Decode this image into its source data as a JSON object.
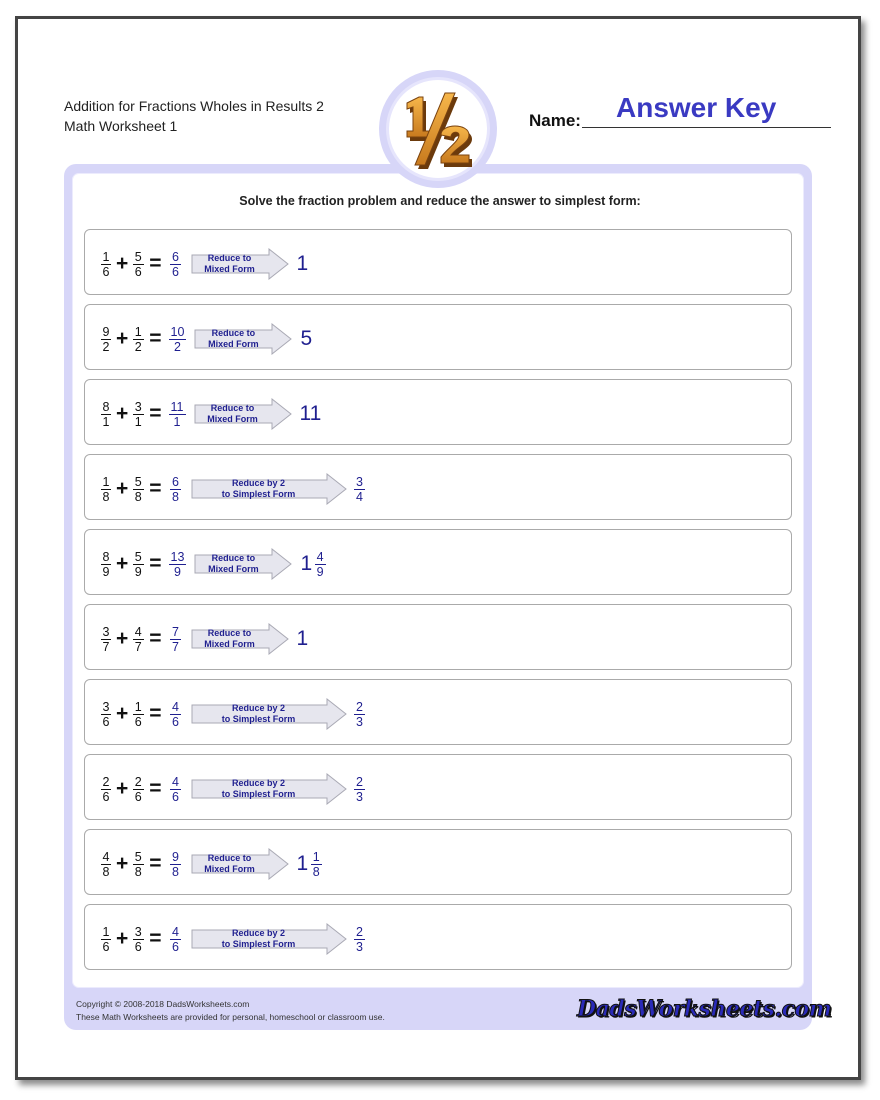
{
  "header": {
    "title_line1": "Addition for Fractions Wholes in Results 2",
    "title_line2": "Math Worksheet 1",
    "name_label": "Name:",
    "name_value": "Answer Key",
    "logo": "one-half-fraction-logo"
  },
  "instructions": "Solve the fraction problem and reduce the answer to simplest form:",
  "colors": {
    "frame": "#d7d6f8",
    "answer_blue": "#1f1f8f",
    "answer_key": "#3a3ac2",
    "logo_orange": "#c87a1e"
  },
  "problems": [
    {
      "a": {
        "n": "1",
        "d": "6"
      },
      "b": {
        "n": "5",
        "d": "6"
      },
      "sum": {
        "n": "6",
        "d": "6"
      },
      "arrow": [
        "Reduce to",
        "Mixed Form"
      ],
      "kind": "mixed",
      "result": {
        "whole": "1"
      }
    },
    {
      "a": {
        "n": "9",
        "d": "2"
      },
      "b": {
        "n": "1",
        "d": "2"
      },
      "sum": {
        "n": "10",
        "d": "2"
      },
      "arrow": [
        "Reduce to",
        "Mixed Form"
      ],
      "kind": "mixed",
      "result": {
        "whole": "5"
      }
    },
    {
      "a": {
        "n": "8",
        "d": "1"
      },
      "b": {
        "n": "3",
        "d": "1"
      },
      "sum": {
        "n": "11",
        "d": "1"
      },
      "arrow": [
        "Reduce to",
        "Mixed Form"
      ],
      "kind": "mixed",
      "result": {
        "whole": "11"
      }
    },
    {
      "a": {
        "n": "1",
        "d": "8"
      },
      "b": {
        "n": "5",
        "d": "8"
      },
      "sum": {
        "n": "6",
        "d": "8"
      },
      "arrow": [
        "Reduce by 2",
        "to Simplest Form"
      ],
      "kind": "simplest",
      "result": {
        "n": "3",
        "d": "4"
      }
    },
    {
      "a": {
        "n": "8",
        "d": "9"
      },
      "b": {
        "n": "5",
        "d": "9"
      },
      "sum": {
        "n": "13",
        "d": "9"
      },
      "arrow": [
        "Reduce to",
        "Mixed Form"
      ],
      "kind": "mixed",
      "result": {
        "whole": "1",
        "n": "4",
        "d": "9"
      }
    },
    {
      "a": {
        "n": "3",
        "d": "7"
      },
      "b": {
        "n": "4",
        "d": "7"
      },
      "sum": {
        "n": "7",
        "d": "7"
      },
      "arrow": [
        "Reduce to",
        "Mixed Form"
      ],
      "kind": "mixed",
      "result": {
        "whole": "1"
      }
    },
    {
      "a": {
        "n": "3",
        "d": "6"
      },
      "b": {
        "n": "1",
        "d": "6"
      },
      "sum": {
        "n": "4",
        "d": "6"
      },
      "arrow": [
        "Reduce by 2",
        "to Simplest Form"
      ],
      "kind": "simplest",
      "result": {
        "n": "2",
        "d": "3"
      }
    },
    {
      "a": {
        "n": "2",
        "d": "6"
      },
      "b": {
        "n": "2",
        "d": "6"
      },
      "sum": {
        "n": "4",
        "d": "6"
      },
      "arrow": [
        "Reduce by 2",
        "to Simplest Form"
      ],
      "kind": "simplest",
      "result": {
        "n": "2",
        "d": "3"
      }
    },
    {
      "a": {
        "n": "4",
        "d": "8"
      },
      "b": {
        "n": "5",
        "d": "8"
      },
      "sum": {
        "n": "9",
        "d": "8"
      },
      "arrow": [
        "Reduce to",
        "Mixed Form"
      ],
      "kind": "mixed",
      "result": {
        "whole": "1",
        "n": "1",
        "d": "8"
      }
    },
    {
      "a": {
        "n": "1",
        "d": "6"
      },
      "b": {
        "n": "3",
        "d": "6"
      },
      "sum": {
        "n": "4",
        "d": "6"
      },
      "arrow": [
        "Reduce by 2",
        "to Simplest Form"
      ],
      "kind": "simplest",
      "result": {
        "n": "2",
        "d": "3"
      }
    }
  ],
  "symbols": {
    "plus": "+",
    "equals": "="
  },
  "footer": {
    "copyright": "Copyright © 2008-2018 DadsWorksheets.com",
    "usage": "These Math Worksheets are provided for personal, homeschool or classroom use.",
    "brand": "DadsWorksheets.com"
  }
}
